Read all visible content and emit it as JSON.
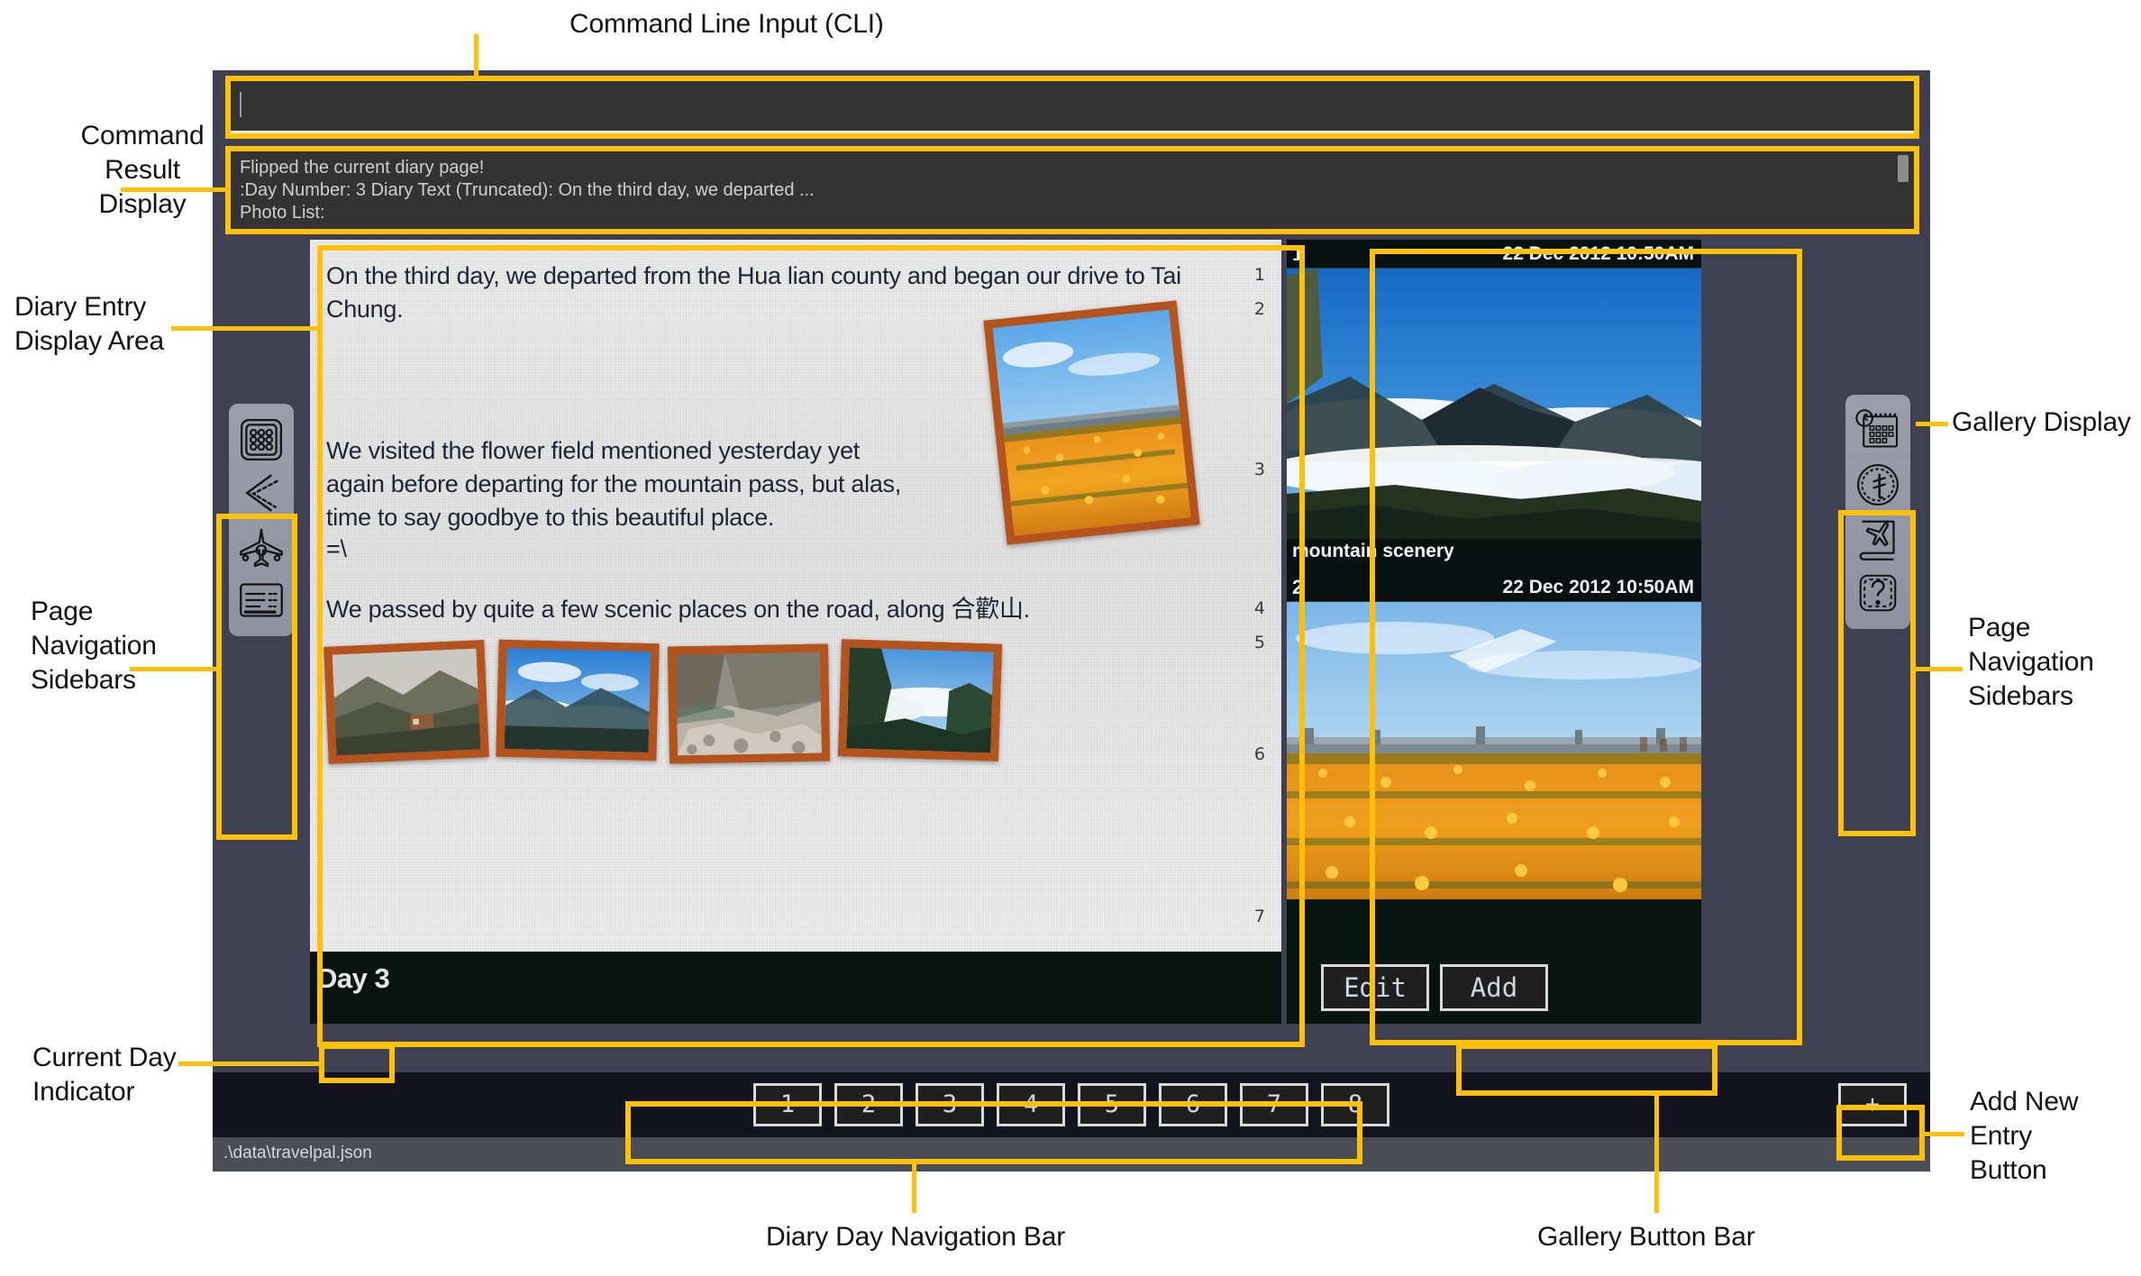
{
  "annotations": {
    "cli_input": "Command Line Input (CLI)",
    "command_result": "Command\nResult\nDisplay",
    "diary_entry_area": "Diary Entry\nDisplay Area",
    "page_nav_left": "Page\nNavigation\nSidebars",
    "page_nav_right": "Page\nNavigation\nSidebars",
    "gallery_display": "Gallery Display",
    "current_day": "Current Day\nIndicator",
    "add_new_entry": "Add New\nEntry\nButton",
    "diary_day_nav": "Diary Day Navigation Bar",
    "gallery_button_bar": "Gallery Button Bar"
  },
  "accent_color": "#ffc107",
  "cli": {
    "input_value": "",
    "placeholder": "",
    "result_lines": [
      "Flipped the current diary page!",
      ":Day Number: 3 Diary Text (Truncated): On the third day, we departed ...",
      "Photo List:"
    ]
  },
  "diary": {
    "paragraphs": [
      "On the third day, we departed from the Hua lian county and began our drive to Tai Chung.",
      "We visited the flower field mentioned yesterday yet again before departing for the mountain pass, but alas, time to say goodbye to this beautiful place.",
      "=\\",
      "We passed by quite a few scenic places on the road, along 合歡山."
    ],
    "line_numbers": [
      "1",
      "2",
      "3",
      "4",
      "5",
      "6",
      "7"
    ],
    "day_label": "Day 3"
  },
  "gallery": {
    "items": [
      {
        "index": "1",
        "date": "22 Dec 2012 10:50AM",
        "caption": "mountain scenery"
      },
      {
        "index": "2",
        "date": "22 Dec 2012 10:50AM",
        "caption": ""
      }
    ],
    "buttons": [
      {
        "label": "Edit",
        "name": "edit-button"
      },
      {
        "label": "Add",
        "name": "add-button"
      }
    ]
  },
  "left_sidebar": {
    "items": [
      {
        "icon": "grid-keypad-icon",
        "name": "sidebar-item-keypad"
      },
      {
        "icon": "chevron-left-ruler-icon",
        "name": "sidebar-item-back"
      },
      {
        "icon": "airplane-icon",
        "name": "sidebar-item-flight"
      },
      {
        "icon": "list-document-icon",
        "name": "sidebar-item-list"
      }
    ]
  },
  "right_sidebar": {
    "items": [
      {
        "icon": "calendar-clock-icon",
        "name": "sidebar-item-schedule"
      },
      {
        "icon": "currency-coin-icon",
        "name": "sidebar-item-currency"
      },
      {
        "icon": "travel-book-icon",
        "name": "sidebar-item-travelbook"
      },
      {
        "icon": "help-question-icon",
        "name": "sidebar-item-help"
      }
    ]
  },
  "day_nav": {
    "days": [
      "1",
      "2",
      "3",
      "4",
      "5",
      "6",
      "7",
      "8"
    ]
  },
  "add_new_entry_label": "+",
  "status_bar": {
    "path": ".\\data\\travelpal.json"
  }
}
